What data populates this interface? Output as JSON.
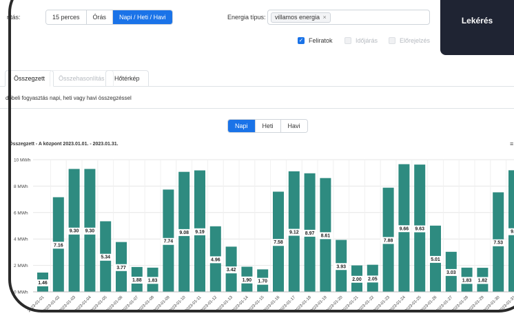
{
  "filters": {
    "granularity_label": "ntás:",
    "granularity_options": [
      "15 perces",
      "Órás",
      "Napi / Heti / Havi"
    ],
    "granularity_selected": 2,
    "energy_label": "Energia típus:",
    "energy_chip": "villamos energia",
    "energy_chip_remove": "×",
    "submit_label": "Lekérés"
  },
  "options": {
    "labels": {
      "label": "Feliratok",
      "checked": true,
      "disabled": false
    },
    "weather": {
      "label": "Időjárás",
      "checked": false,
      "disabled": true
    },
    "forecast": {
      "label": "Előrejelzés",
      "checked": false,
      "disabled": true
    }
  },
  "tabs": [
    {
      "label": "Összegzett",
      "state": "active"
    },
    {
      "label": "Összehasonlítás",
      "state": "disabled"
    },
    {
      "label": "Hőtérkép",
      "state": "normal"
    }
  ],
  "description": "dőbeli fogyasztás napi, heti vagy havi összegzéssel",
  "period": {
    "options": [
      "Napi",
      "Heti",
      "Havi"
    ],
    "selected": 0
  },
  "chart_title": "Összegzett - A központ 2023.01.01. - 2023.01.31.",
  "menu_glyph": "≡",
  "colors": {
    "accent": "#1a73e8",
    "bar": "#2e8b80",
    "dark_button": "#1f2433"
  },
  "chart_data": {
    "type": "bar",
    "title": "Összegzett - A központ 2023.01.01. - 2023.01.31.",
    "ylim": [
      0,
      10
    ],
    "yticks": [
      "0 MWh",
      "2 MWh",
      "4 MWh",
      "6 MWh",
      "8 MWh",
      "10 MWh"
    ],
    "categories": [
      "2023-01-01",
      "2023-01-02",
      "2023-01-03",
      "2023-01-04",
      "2023-01-05",
      "2023-01-06",
      "2023-01-07",
      "2023-01-08",
      "2023-01-09",
      "2023-01-10",
      "2023-01-11",
      "2023-01-12",
      "2023-01-13",
      "2023-01-14",
      "2023-01-15",
      "2023-01-16",
      "2023-01-17",
      "2023-01-18",
      "2023-01-19",
      "2023-01-20",
      "2023-01-21",
      "2023-01-22",
      "2023-01-23",
      "2023-01-24",
      "2023-01-25",
      "2023-01-26",
      "2023-01-27",
      "2023-01-28",
      "2023-01-29",
      "2023-01-30",
      "2023-01-31"
    ],
    "values": [
      1.46,
      7.16,
      9.3,
      9.3,
      5.34,
      3.77,
      1.88,
      1.83,
      7.74,
      9.08,
      9.19,
      4.96,
      3.42,
      1.9,
      1.7,
      7.58,
      9.12,
      8.97,
      8.61,
      3.93,
      2.0,
      2.05,
      7.88,
      9.66,
      9.63,
      5.01,
      3.03,
      1.83,
      1.82,
      7.53,
      9.2
    ],
    "data_labels": [
      "1.46",
      "7.16",
      "9.30",
      "9.30",
      "5.34",
      "3.77",
      "1.88",
      "1.83",
      "7.74",
      "9.08",
      "9.19",
      "4.96",
      "3.42",
      "1.90",
      "1.70",
      "7.58",
      "9.12",
      "8.97",
      "8.61",
      "3.93",
      "2.00",
      "2.05",
      "7.88",
      "9.66",
      "9.63",
      "5.01",
      "3.03",
      "1.83",
      "1.82",
      "7.53",
      "9.2"
    ],
    "grid": true
  }
}
